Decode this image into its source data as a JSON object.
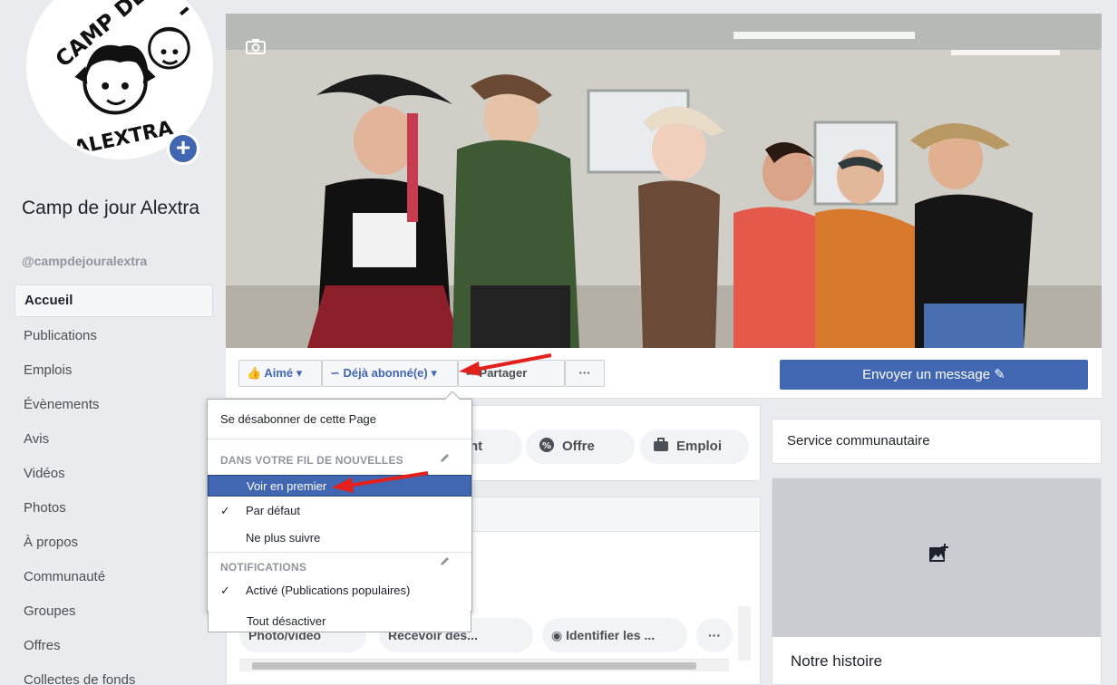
{
  "page": {
    "name": "Camp de jour Alextra",
    "handle": "@campdejouralextra",
    "avatar_text_top": "CAMP DE JOUR",
    "avatar_text_bottom": "ALEXTRA"
  },
  "nav": [
    {
      "label": "Accueil",
      "active": true
    },
    {
      "label": "Publications"
    },
    {
      "label": "Emplois"
    },
    {
      "label": "Évènements"
    },
    {
      "label": "Avis"
    },
    {
      "label": "Vidéos"
    },
    {
      "label": "Photos"
    },
    {
      "label": "À propos"
    },
    {
      "label": "Communauté"
    },
    {
      "label": "Groupes"
    },
    {
      "label": "Offres"
    },
    {
      "label": "Collectes de fonds"
    }
  ],
  "actions": {
    "liked": "Aimé",
    "following": "Déjà abonné(e)",
    "share": "Partager",
    "more": "···",
    "message": "Envoyer un message"
  },
  "pills": {
    "event": "ement",
    "offer": "Offre",
    "job": "Emploi"
  },
  "composer": {
    "photo": "Photo/vidéo",
    "receive": "Recevoir des...",
    "identify": "Identifier les ...",
    "more": "···"
  },
  "right": {
    "service": "Service communautaire",
    "story": "Notre histoire"
  },
  "dropdown": {
    "unsubscribe": "Se désabonner de cette Page",
    "feed_header": "DANS VOTRE FIL DE NOUVELLES",
    "see_first": "Voir en premier",
    "default": "Par défaut",
    "unfollow": "Ne plus suivre",
    "notifications_header": "NOTIFICATIONS",
    "on_popular": "Activé (Publications populaires)",
    "all_off": "Tout désactiver",
    "check": "✓"
  },
  "colors": {
    "brand_blue": "#4267b2",
    "arrow_red": "#e3201b",
    "background": "#e9ebee"
  }
}
